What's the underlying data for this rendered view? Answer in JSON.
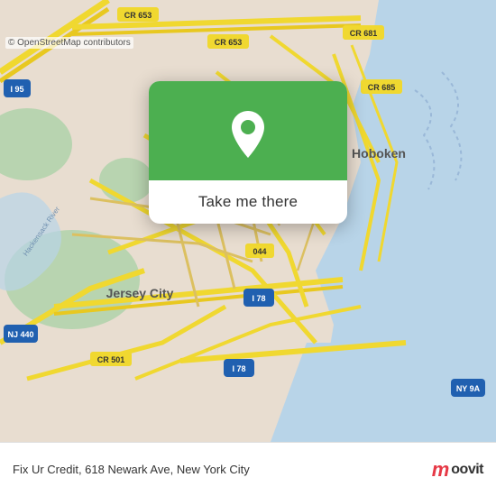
{
  "map": {
    "background_color": "#e8e0d8",
    "water_color": "#c8dff0",
    "park_color": "#c8dfc0",
    "road_color": "#f5e070"
  },
  "popup": {
    "pin_color": "#4CAF50",
    "button_label": "Take me there"
  },
  "bottom_bar": {
    "address": "Fix Ur Credit, 618 Newark Ave, New York City",
    "copyright": "© OpenStreetMap contributors",
    "logo_m": "m",
    "logo_text": "oovit"
  }
}
